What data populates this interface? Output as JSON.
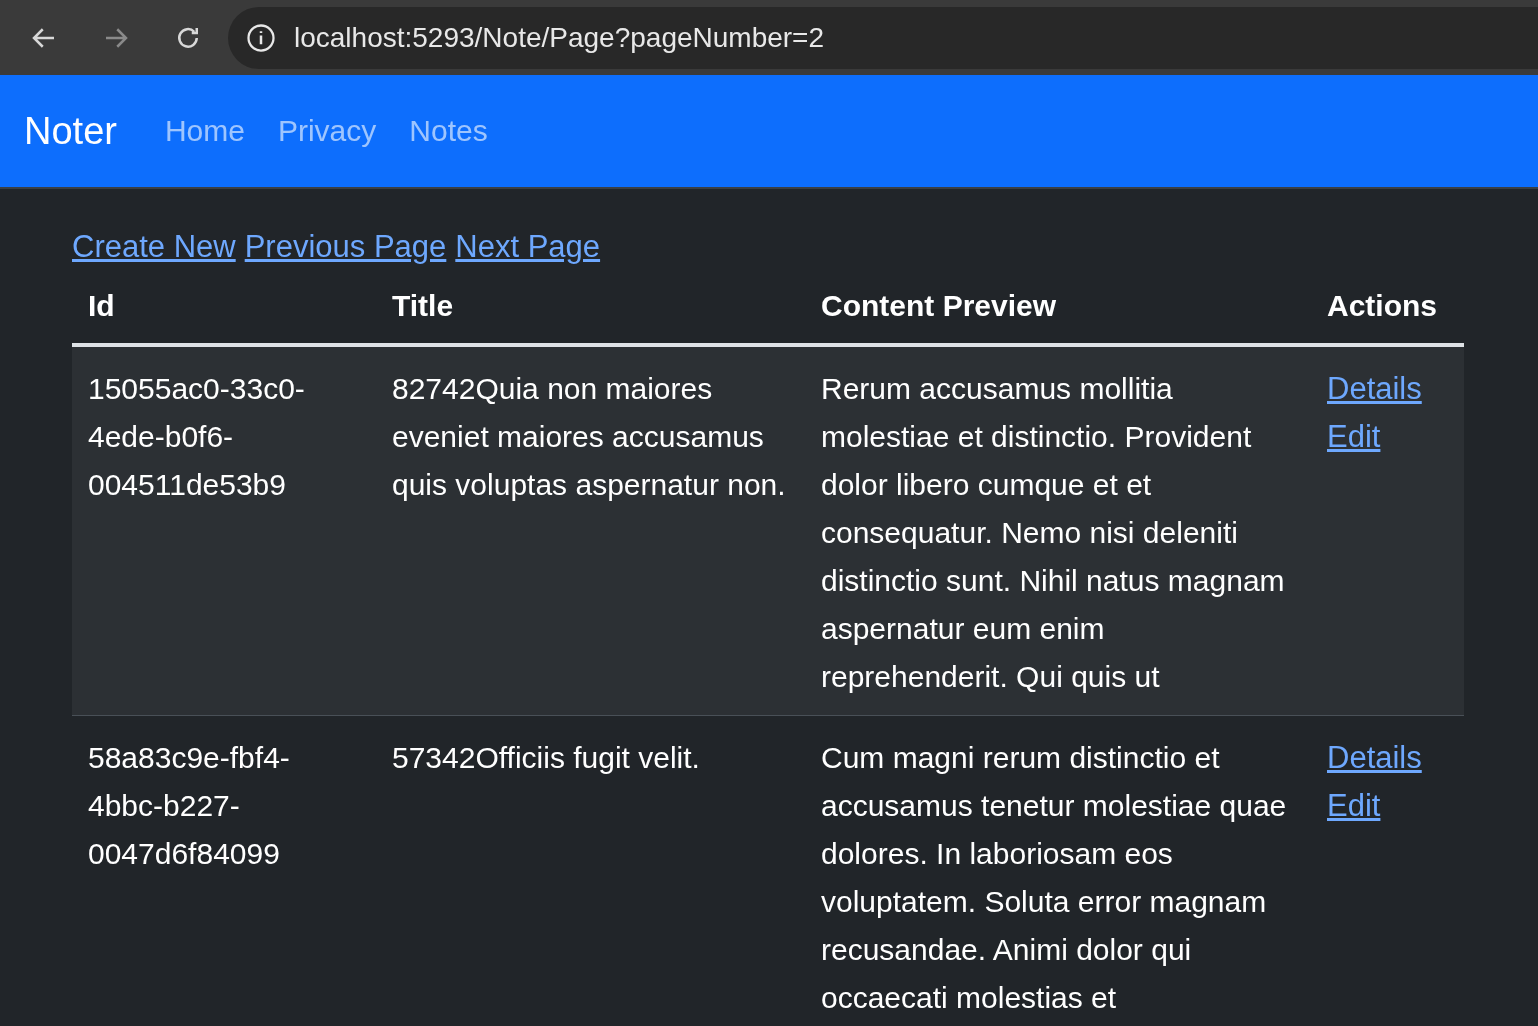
{
  "browser": {
    "buttons": [
      {
        "kind": "back",
        "disabled": false
      },
      {
        "kind": "forward",
        "disabled": true
      },
      {
        "kind": "reload",
        "disabled": false
      }
    ],
    "url": "localhost:5293/Note/Page?pageNumber=2"
  },
  "navbar": {
    "brand": "Noter",
    "links": [
      "Home",
      "Privacy",
      "Notes"
    ]
  },
  "actions": [
    "Create New",
    "Previous Page",
    "Next Page"
  ],
  "table": {
    "columns": [
      "Id",
      "Title",
      "Content Preview",
      "Actions"
    ],
    "rows": [
      {
        "id": "15055ac0-33c0-4ede-b0f6-004511de53b9",
        "title": "82742Quia non maiores eveniet maiores accusamus quis voluptas aspernatur non.",
        "content": "Rerum accusamus mollitia molestiae et distinctio. Provident dolor libero cumque et et consequatur. Nemo nisi deleniti distinctio sunt. Nihil natus magnam aspernatur eum enim reprehenderit. Qui quis ut",
        "links": [
          "Details",
          "Edit"
        ]
      },
      {
        "id": "58a83c9e-fbf4-4bbc-b227-0047d6f84099",
        "title": "57342Officiis fugit velit.",
        "content": "Cum magni rerum distinctio et accusamus tenetur molestiae quae dolores. In laboriosam eos voluptatem. Soluta error magnam recusandae. Animi dolor qui occaecati molestias et",
        "links": [
          "Details",
          "Edit"
        ]
      }
    ]
  }
}
